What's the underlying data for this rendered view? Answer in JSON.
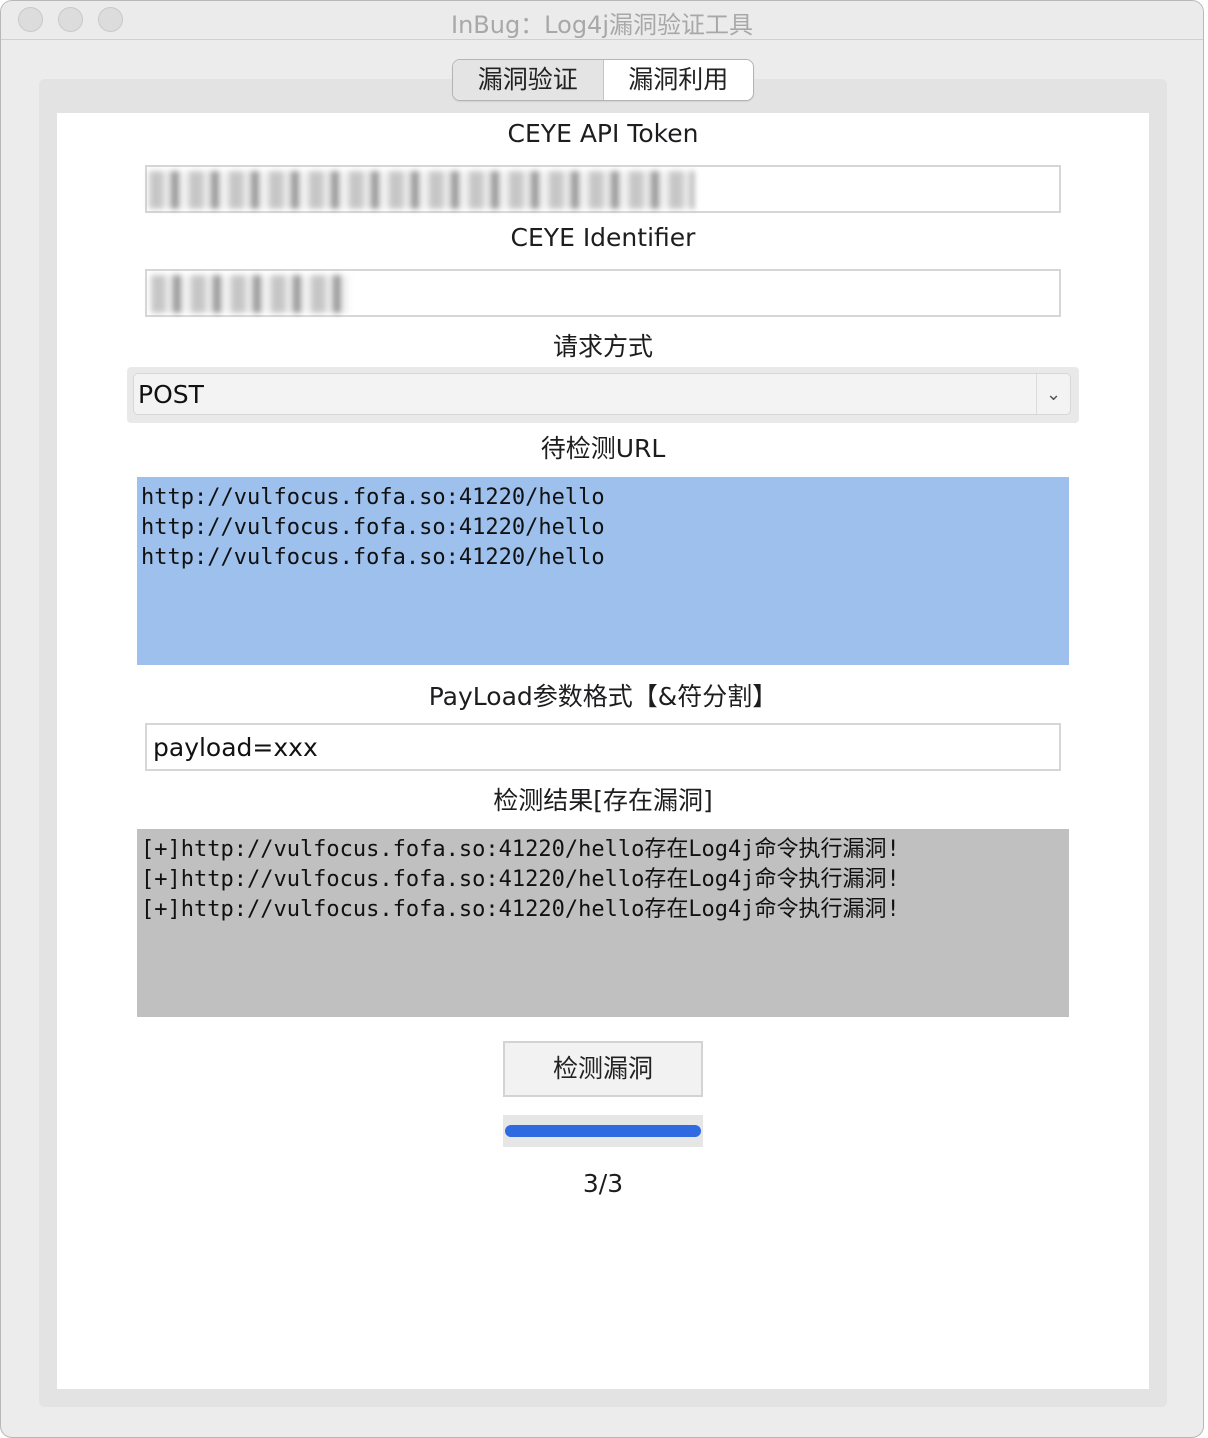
{
  "window": {
    "title": "InBug：Log4j漏洞验证工具"
  },
  "tabs": [
    {
      "label": "漏洞验证",
      "active": true
    },
    {
      "label": "漏洞利用",
      "active": false
    }
  ],
  "form": {
    "token_label": "CEYE API Token",
    "identifier_label": "CEYE Identifier",
    "method_label": "请求方式",
    "method_value": "POST",
    "url_label": "待检测URL",
    "urls": "http://vulfocus.fofa.so:41220/hello\nhttp://vulfocus.fofa.so:41220/hello\nhttp://vulfocus.fofa.so:41220/hello",
    "payload_label": "PayLoad参数格式【&符分割】",
    "payload_value": "payload=xxx",
    "result_label": "检测结果[存在漏洞]",
    "results": "[+]http://vulfocus.fofa.so:41220/hello存在Log4j命令执行漏洞!\n[+]http://vulfocus.fofa.so:41220/hello存在Log4j命令执行漏洞!\n[+]http://vulfocus.fofa.so:41220/hello存在Log4j命令执行漏洞!",
    "check_button": "检测漏洞",
    "progress": 1.0,
    "counter": "3/3"
  },
  "colors": {
    "url_box": "#9dc0ec",
    "result_box": "#c0c0c0",
    "progress": "#2f6ae1"
  },
  "icons": {
    "select_arrow": "chevron-down-icon"
  }
}
